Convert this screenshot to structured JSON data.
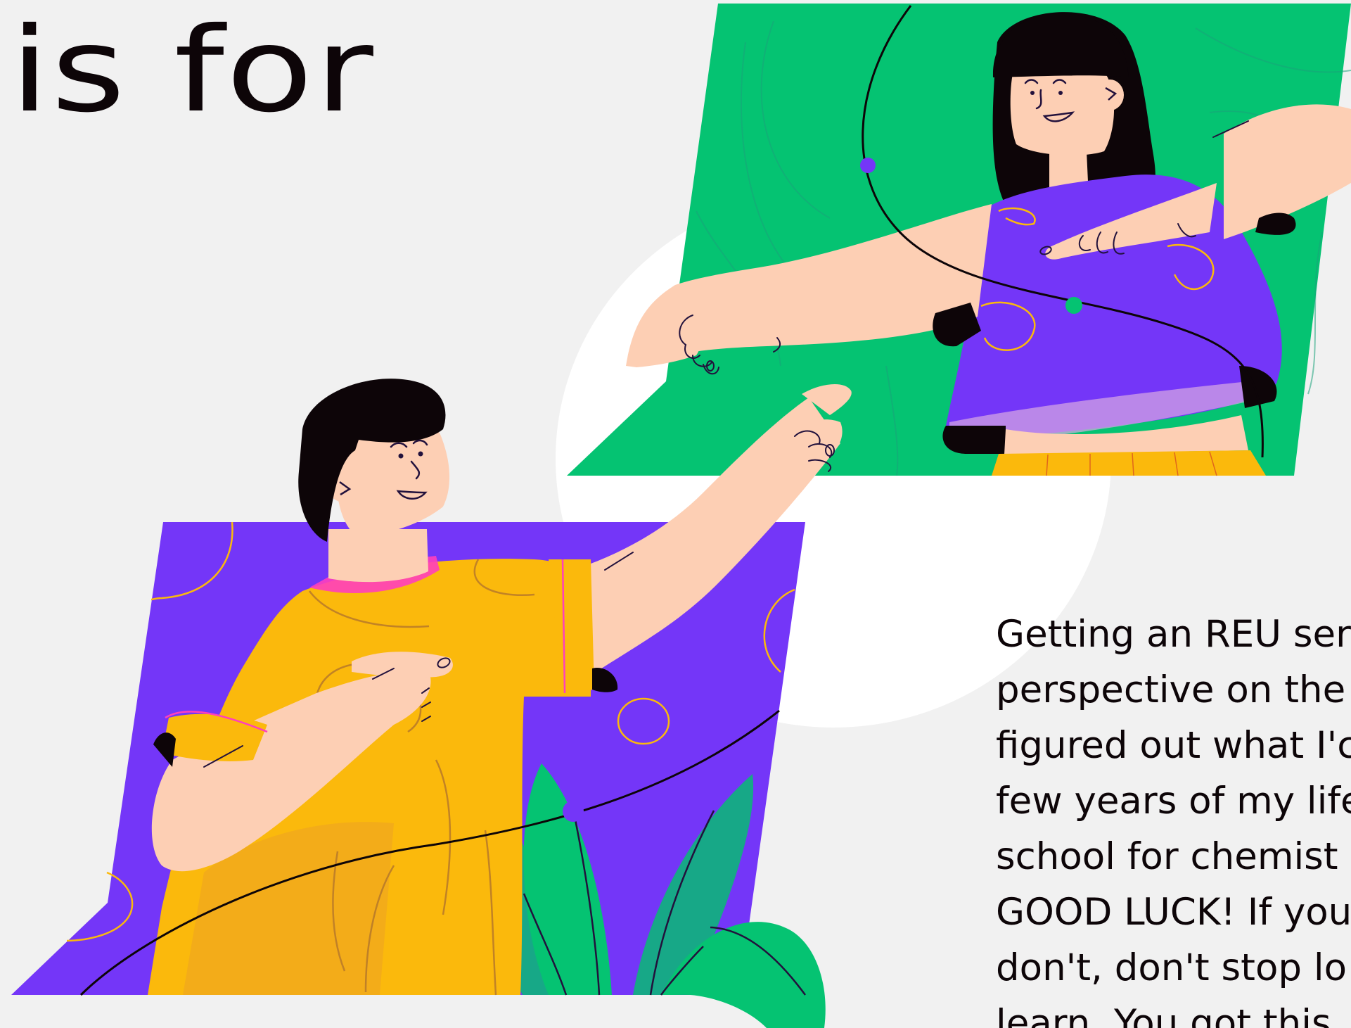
{
  "heading": {
    "text": "is for"
  },
  "quote": {
    "lines": [
      "Getting an REU ser",
      "perspective on the",
      "figured out what I'c",
      "few years of my life",
      "school for chemist",
      "GOOD LUCK! If you",
      "don't, don't stop lo",
      "learn. You got this"
    ]
  },
  "colors": {
    "background": "#f1f1f1",
    "green": "#05c372",
    "purple": "#7436f8",
    "yellow": "#fbb90c",
    "skin": "#fdcfb4",
    "hair": "#0d0508",
    "text": "#0d0508"
  },
  "illustration": {
    "subject": "two-people-pointing-illustration"
  }
}
